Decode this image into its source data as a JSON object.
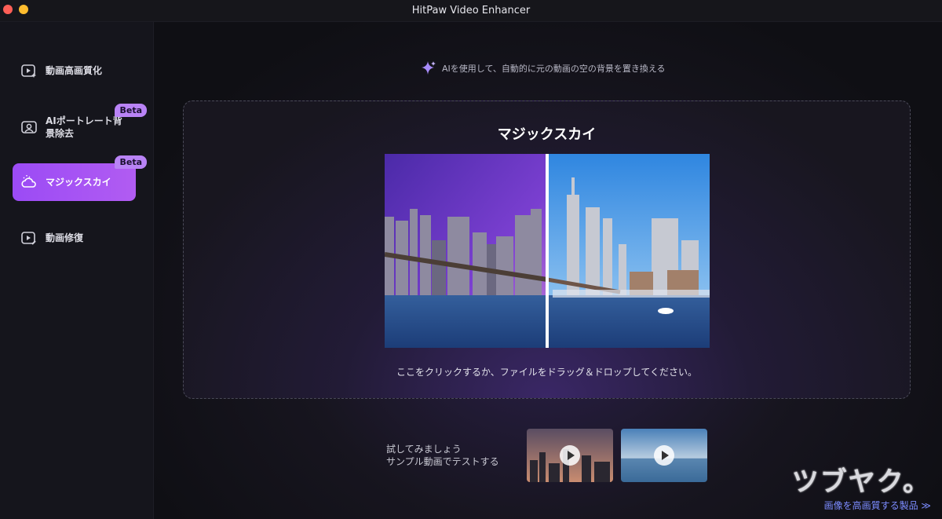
{
  "window": {
    "title": "HitPaw Video Enhancer"
  },
  "sidebar": {
    "items": [
      {
        "label": "動画高画質化",
        "icon": "video-enhance-icon",
        "badge": ""
      },
      {
        "label": "AIポートレート背景除去",
        "icon": "portrait-icon",
        "badge": "Beta"
      },
      {
        "label": "マジックスカイ",
        "icon": "cloud-sun-icon",
        "badge": "Beta",
        "active": true
      },
      {
        "label": "動画修復",
        "icon": "video-repair-icon",
        "badge": ""
      }
    ]
  },
  "main": {
    "hint": "AIを使用して、自動的に元の動画の空の背景を置き換える",
    "dropzone": {
      "title": "マジックスカイ",
      "caption": "ここをクリックするか、ファイルをドラッグ＆ドロップしてください。"
    },
    "samples": {
      "line1": "試してみましょう",
      "line2": "サンプル動画でテストする"
    }
  },
  "watermark": {
    "logo": "ツブヤク。",
    "link": "画像を高画質する製品 ≫"
  },
  "colors": {
    "accent": "#a355f4",
    "badge": "#b983f6",
    "link": "#7c8cff"
  }
}
